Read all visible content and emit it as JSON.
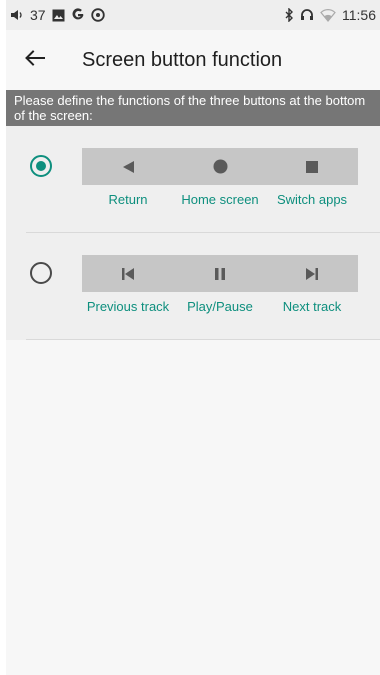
{
  "status_bar": {
    "volume_level": "37",
    "time": "11:56",
    "left_icons": [
      "volume-icon",
      "image-icon",
      "google-g-icon",
      "at-icon"
    ],
    "right_icons": [
      "bluetooth-icon",
      "headset-icon",
      "wifi-icon"
    ]
  },
  "app_bar": {
    "title": "Screen button function",
    "back_icon": "arrow-left-icon"
  },
  "description": "Please define the functions of the three buttons at the bottom of the screen:",
  "options": [
    {
      "selected": true,
      "icons": [
        "back-triangle-icon",
        "home-circle-icon",
        "square-icon"
      ],
      "labels": [
        "Return",
        "Home screen",
        "Switch apps"
      ]
    },
    {
      "selected": false,
      "icons": [
        "previous-track-icon",
        "play-pause-icon",
        "next-track-icon"
      ],
      "labels": [
        "Previous track",
        "Play/Pause",
        "Next track"
      ]
    }
  ],
  "colors": {
    "accent": "#0e8f7e",
    "banner": "#767676",
    "button_bar": "#c6c6c6",
    "icon": "#5a5a5a"
  }
}
